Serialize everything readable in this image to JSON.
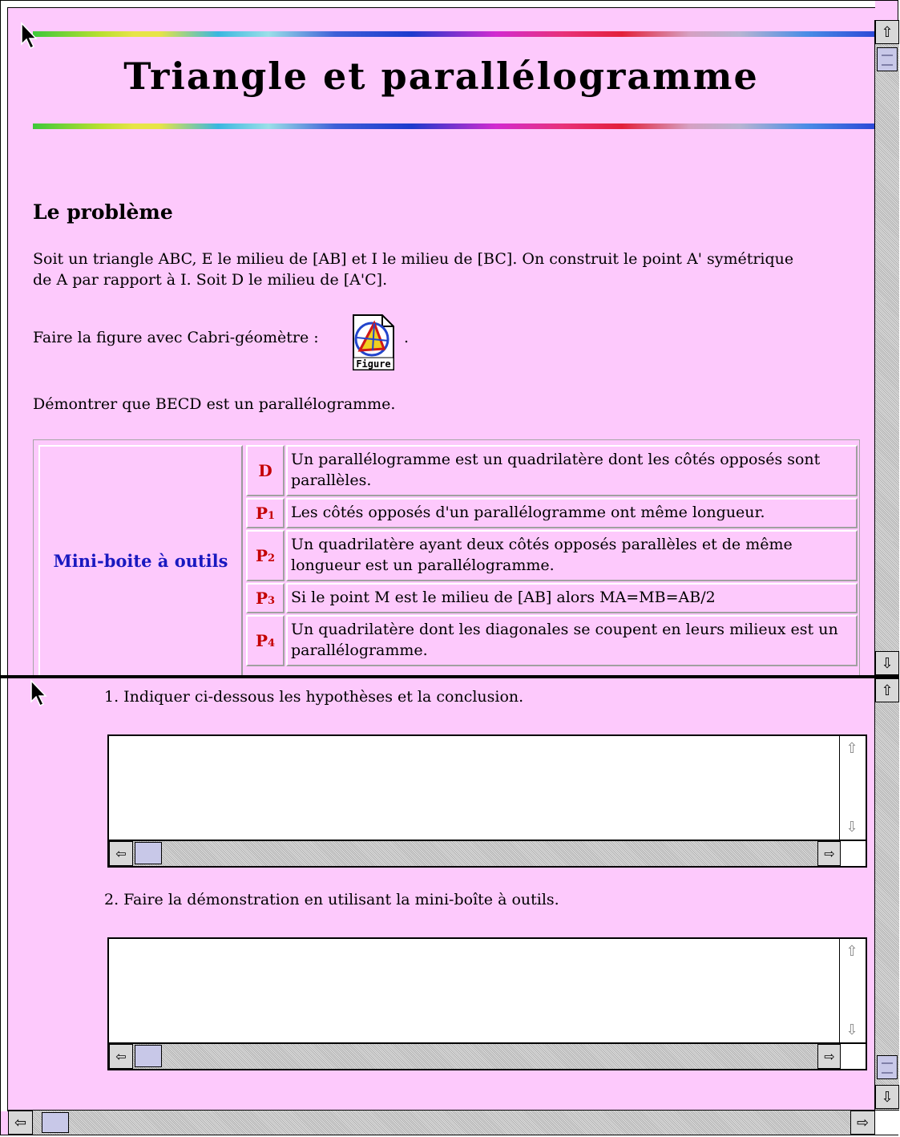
{
  "page": {
    "title": "Triangle et parallélogramme",
    "section_heading": "Le problème",
    "problem_text": "Soit un triangle ABC, E le milieu de [AB] et I le milieu de [BC]. On construit le point A' symétrique de A par rapport à I.  Soit D le milieu de [A'C].",
    "figure_prompt": "Faire la figure avec Cabri-géomètre :",
    "figure_icon_label": "Figure",
    "figure_trailing": ".",
    "demonstrate_text": "Démontrer que BECD est un parallélogramme."
  },
  "toolbox": {
    "title": "Mini-boite à outils",
    "rows": [
      {
        "code": "D",
        "sub": "",
        "text": "Un parallélogramme est un quadrilatère dont les côtés opposés sont parallèles."
      },
      {
        "code": "P",
        "sub": "1",
        "text": "Les côtés opposés d'un parallélogramme ont même longueur."
      },
      {
        "code": "P",
        "sub": "2",
        "text": "Un quadrilatère ayant deux côtés opposés parallèles et de même longueur est un parallélogramme."
      },
      {
        "code": "P",
        "sub": "3",
        "text": "Si le point M est le milieu de [AB] alors MA=MB=AB/2"
      },
      {
        "code": "P",
        "sub": "4",
        "text": "Un quadrilatère dont les diagonales se coupent en leurs milieux est un parallélogramme."
      }
    ]
  },
  "questions": {
    "q1": "1. Indiquer ci-dessous les hypothèses et la conclusion.",
    "q1_value": "",
    "q2": "2. Faire la démonstration en utilisant la mini-boîte à outils.",
    "q2_value": ""
  },
  "icons": {
    "scroll_up": "up-arrow-icon",
    "scroll_down": "down-arrow-icon",
    "scroll_left": "left-arrow-icon",
    "scroll_right": "right-arrow-icon",
    "cursor": "mouse-pointer-icon"
  },
  "colors": {
    "page_background": "#fdc9fc",
    "toolbox_title": "#1919c0",
    "rule_code": "#c40000"
  }
}
